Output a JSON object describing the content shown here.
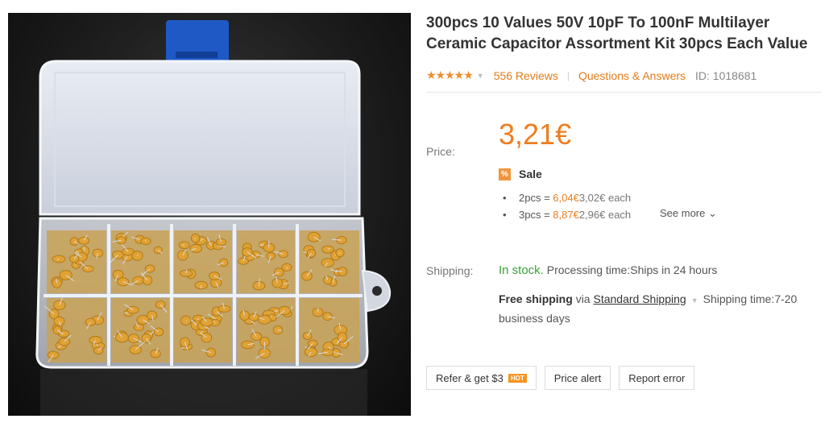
{
  "product": {
    "title": "300pcs 10 Values 50V 10pF To 100nF Multilayer Ceramic Capacitor Assortment Kit 30pcs Each Value",
    "image_alt": "Ceramic capacitor assortment box"
  },
  "rating": {
    "stars_glyph": "★★★★★",
    "stars_value": 5,
    "reviews_label": "556 Reviews",
    "qa_label": "Questions & Answers",
    "id_label": "ID: 1018681"
  },
  "price": {
    "label": "Price:",
    "value": "3,21€",
    "sale_label": "Sale",
    "sale_icon": "%",
    "tiers": [
      {
        "qty": "2pcs = ",
        "total": "6,04€",
        "each": "3,02€ each"
      },
      {
        "qty": "3pcs = ",
        "total": "8,87€",
        "each": "2,96€ each"
      }
    ],
    "see_more": "See more"
  },
  "shipping": {
    "label": "Shipping:",
    "stock": "In stock.",
    "processing": "Processing time:Ships in 24 hours",
    "free": "Free shipping",
    "via": "via",
    "method": "Standard Shipping",
    "time": "Shipping time:7-20 business days"
  },
  "actions": {
    "refer_label": "Refer & get $3",
    "hot_badge": "HOT",
    "alert_label": "Price alert",
    "report_label": "Report error"
  },
  "colors": {
    "accent": "#ee7d1f",
    "stock_green": "#3ca335",
    "capacitor": "#e0a234"
  }
}
